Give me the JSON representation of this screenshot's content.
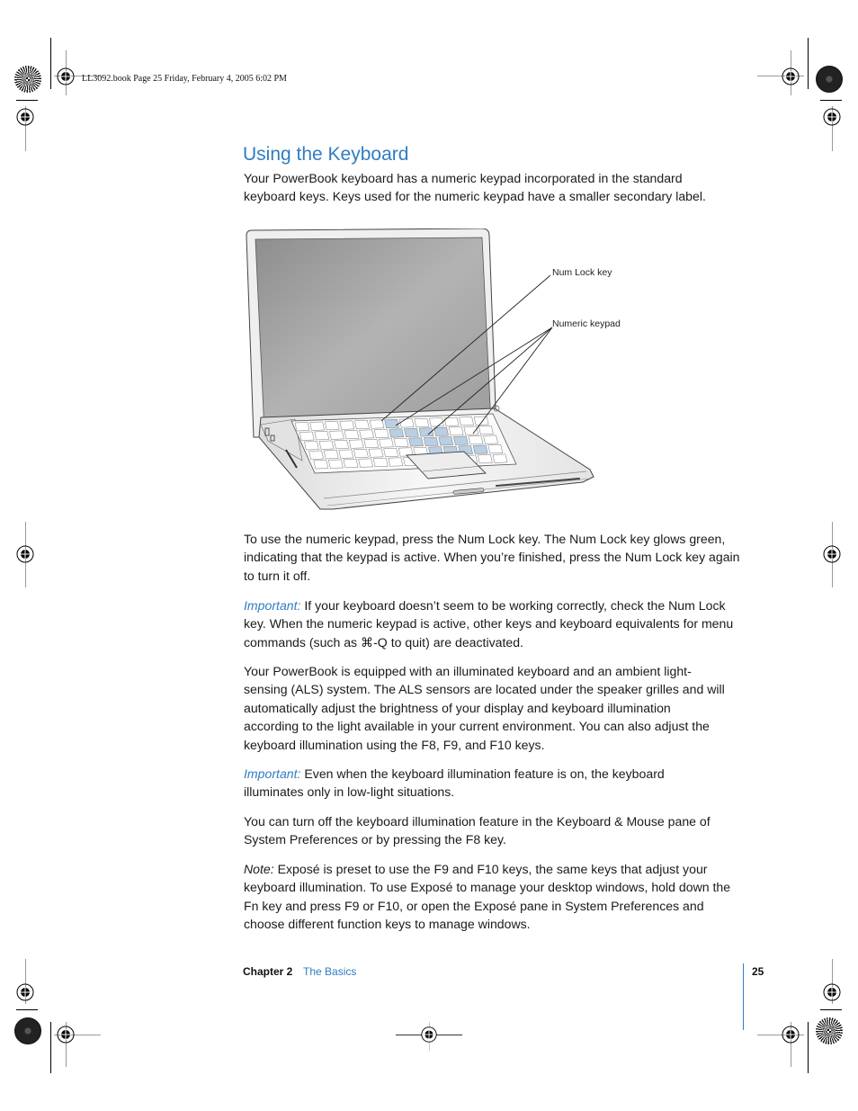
{
  "slug": {
    "text": "LL3092.book  Page 25  Friday, February 4, 2005  6:02 PM"
  },
  "section": {
    "title": "Using the Keyboard",
    "intro": "Your PowerBook keyboard has a numeric keypad incorporated in the standard keyboard keys. Keys used for the numeric keypad have a smaller secondary label."
  },
  "figure": {
    "description": "PowerBook laptop illustration with numeric keypad keys highlighted",
    "callouts": [
      {
        "label": "Num Lock key"
      },
      {
        "label": "Numeric keypad"
      }
    ],
    "highlight_color": "#b9cfe4"
  },
  "body": [
    {
      "label": "",
      "text": "To use the numeric keypad, press the Num Lock key. The Num Lock key glows green, indicating that the keypad is active. When you’re finished, press the Num Lock key again to turn it off."
    },
    {
      "label": "Important:",
      "text": " If your keyboard doesn’t seem to be working correctly, check the Num Lock key. When the numeric keypad is active, other keys and keyboard equivalents for menu commands (such as ⌘-Q to quit) are deactivated."
    },
    {
      "label": "",
      "text": "Your PowerBook is equipped with an illuminated keyboard and an ambient light-sensing (ALS) system. The ALS sensors are located under the speaker grilles and will automatically adjust the brightness of your display and keyboard illumination according to the light available in your current environment. You can also adjust the keyboard illumination using the F8, F9, and F10 keys."
    },
    {
      "label": "Important:",
      "text": " Even when the keyboard illumination feature is on, the keyboard illuminates only in low-light situations."
    },
    {
      "label": "",
      "text": "You can turn off the keyboard illumination feature in the Keyboard & Mouse pane of System Preferences or by pressing the F8 key."
    },
    {
      "label": "Note:",
      "text": " Exposé is preset to use the F9 and F10 keys, the same keys that adjust your keyboard illumination. To use Exposé to manage your desktop windows, hold down the Fn key and press F9 or F10, or open the Exposé pane in System Preferences and choose different function keys to manage windows."
    }
  ],
  "footer": {
    "chapter": "Chapter 2",
    "section": "The Basics",
    "page_number": "25"
  },
  "colors": {
    "accent": "#2f7dc1",
    "text": "#1a1a1a"
  }
}
